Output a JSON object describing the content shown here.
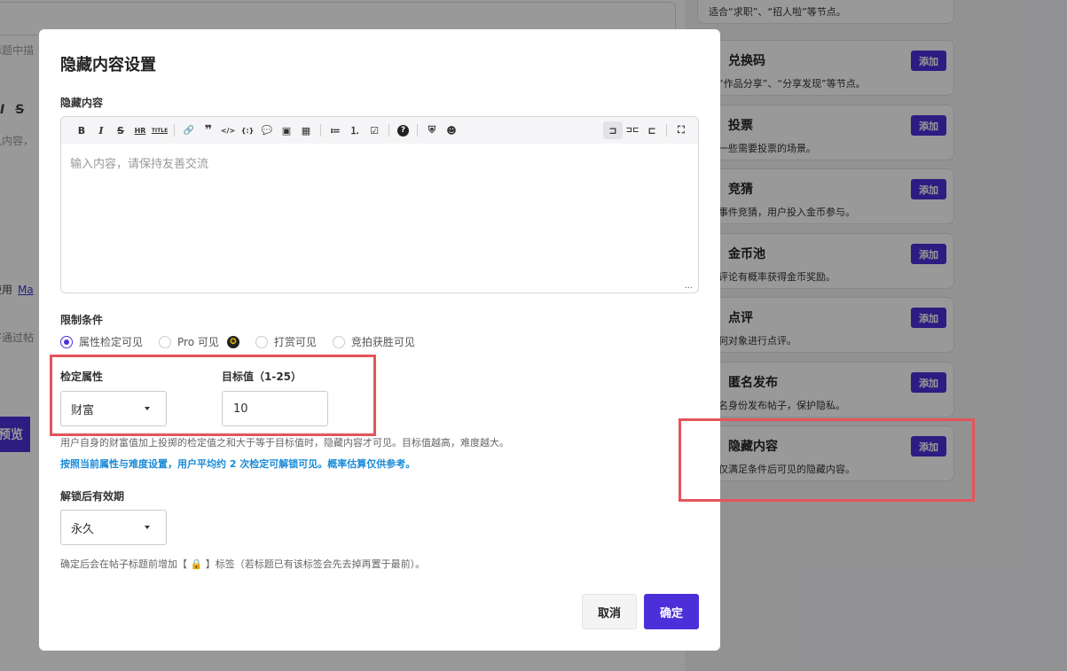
{
  "background": {
    "title_placeholder": "标题中描",
    "format_icons": [
      "I",
      "S"
    ],
    "editor_placeholder": "入内容，",
    "use_text": "使用",
    "use_link": "Ma",
    "hint_text": "将通过帖",
    "preview_label": "预览",
    "plugins": [
      {
        "title": "",
        "desc": "适合“求职”、“招人啦”等节点。",
        "add": "添加"
      },
      {
        "title": "兑换码",
        "desc": "合“作品分享”、“分享发现”等节点。",
        "add": "添加"
      },
      {
        "title": "投票",
        "desc": "合一些需要投票的场景。",
        "add": "添加"
      },
      {
        "title": "竞猜",
        "desc": "起事件竞猜，用户投入金币参与。",
        "add": "添加"
      },
      {
        "title": "金币池",
        "desc": "户评论有概率获得金币奖励。",
        "add": "添加"
      },
      {
        "title": "点评",
        "desc": "任何对象进行点评。",
        "add": "添加"
      },
      {
        "title": "匿名发布",
        "desc": "匿名身份发布帖子，保护隐私。",
        "add": "添加"
      },
      {
        "title": "隐藏内容",
        "desc": "置仅满足条件后可见的隐藏内容。",
        "add": "添加"
      }
    ]
  },
  "modal": {
    "title": "隐藏内容设置",
    "content_label": "隐藏内容",
    "editor_placeholder": "输入内容，请保持友善交流",
    "editor_more": "...",
    "toolbar_icons": [
      "bold-icon",
      "italic-icon",
      "strike-icon",
      "hr-icon",
      "title-icon",
      "link-icon",
      "quote-icon",
      "code-icon",
      "code-block-icon",
      "comment-icon",
      "image-icon",
      "table-icon",
      "list-icon",
      "ordered-list-icon",
      "check-list-icon",
      "help-icon",
      "shield-icon",
      "emoji-icon",
      "layout-left-icon",
      "layout-center-icon",
      "layout-right-icon",
      "fullscreen-icon"
    ],
    "toolbar_glyphs": [
      "B",
      "I",
      "S",
      "HR",
      "TITLE",
      "🔗",
      "❞",
      "</>",
      "{:}",
      "💬",
      "▣",
      "▦",
      "≔",
      "⒈",
      "☑",
      "?",
      "⛨",
      "☻",
      "⊐",
      "⊐⊏",
      "⊏",
      "⛶"
    ],
    "condition_label": "限制条件",
    "conditions": [
      {
        "label": "属性检定可见",
        "checked": true
      },
      {
        "label": "Pro 可见",
        "checked": false
      },
      {
        "label": "打赏可见",
        "checked": false
      },
      {
        "label": "竞拍获胜可见",
        "checked": false
      }
    ],
    "attr_label": "检定属性",
    "attr_value": "财富",
    "target_label": "目标值（1-25）",
    "target_value": "10",
    "desc_main": "用户自身的财富值加上投掷的检定值之和大于等于目标值时，隐藏内容才可见。目标值越高，难度越大。",
    "desc_blue": "按照当前属性与难度设置，用户平均约 2 次检定可解锁可见。概率估算仅供参考。",
    "expiry_label": "解锁后有效期",
    "expiry_value": "永久",
    "footer_note": "确定后会在帖子标题前增加【 🔒 】标签（若标题已有该标签会先去掉再置于最前）。",
    "cancel": "取消",
    "confirm": "确定"
  },
  "colors": {
    "accent": "#4c2fd9",
    "highlight": "#e4555a",
    "info": "#1a8bd8"
  }
}
